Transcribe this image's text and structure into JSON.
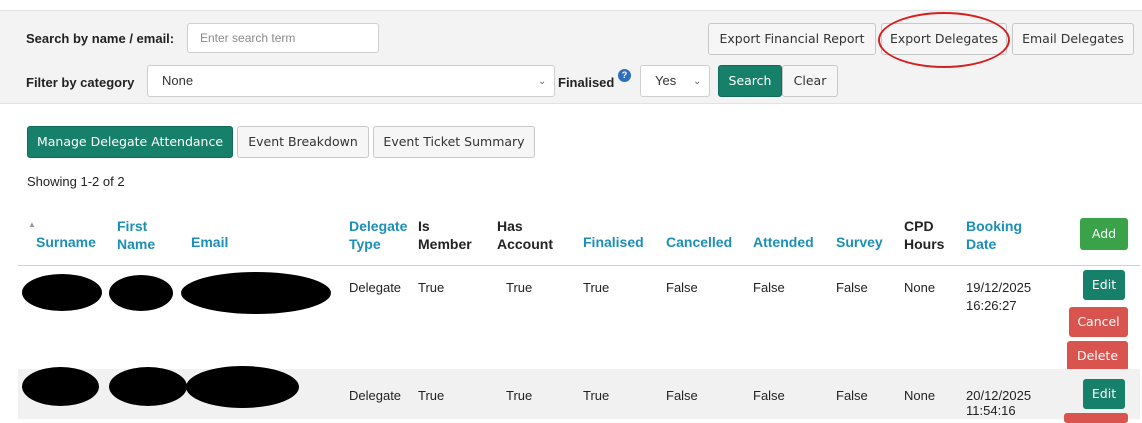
{
  "filters": {
    "search_label": "Search by name / email:",
    "search_placeholder": "Enter search term",
    "category_label": "Filter by category",
    "category_value": "None",
    "finalised_label": "Finalised",
    "finalised_value": "Yes",
    "search_button": "Search",
    "clear_button": "Clear"
  },
  "exports": {
    "financial": "Export Financial Report",
    "delegates": "Export Delegates",
    "email": "Email Delegates"
  },
  "tabs": {
    "manage": "Manage Delegate Attendance",
    "breakdown": "Event Breakdown",
    "ticket_summary": "Event Ticket Summary"
  },
  "showing": "Showing 1-2 of 2",
  "table": {
    "headers": {
      "surname": "Surname",
      "first_name_1": "First",
      "first_name_2": "Name",
      "email": "Email",
      "delegate_type_1": "Delegate",
      "delegate_type_2": "Type",
      "is_member_1": "Is",
      "is_member_2": "Member",
      "has_account_1": "Has",
      "has_account_2": "Account",
      "finalised": "Finalised",
      "cancelled": "Cancelled",
      "attended": "Attended",
      "survey": "Survey",
      "cpd_hours_1": "CPD",
      "cpd_hours_2": "Hours",
      "booking_date_1": "Booking",
      "booking_date_2": "Date"
    },
    "add_button": "Add",
    "rows": [
      {
        "delegate_type": "Delegate",
        "is_member": "True",
        "has_account": "True",
        "finalised": "True",
        "cancelled": "False",
        "attended": "False",
        "survey": "False",
        "cpd_hours": "None",
        "booking_date": "19/12/2025",
        "booking_time": "16:26:27",
        "edit": "Edit",
        "cancel": "Cancel",
        "delete": "Delete"
      },
      {
        "delegate_type": "Delegate",
        "is_member": "True",
        "has_account": "True",
        "finalised": "True",
        "cancelled": "False",
        "attended": "False",
        "survey": "False",
        "cpd_hours": "None",
        "booking_date": "20/12/2025",
        "booking_time": "11:54:16",
        "edit": "Edit"
      }
    ]
  },
  "colors": {
    "teal": "#17806a",
    "green": "#3aa34a",
    "red": "#d9534f",
    "link_blue": "#1b8fb8",
    "annotation_red": "#d62020"
  },
  "icons": {
    "finalised_help": "question-circle-icon",
    "sort": "sort-caret-icon",
    "select_chevron": "chevron-down-icon"
  }
}
